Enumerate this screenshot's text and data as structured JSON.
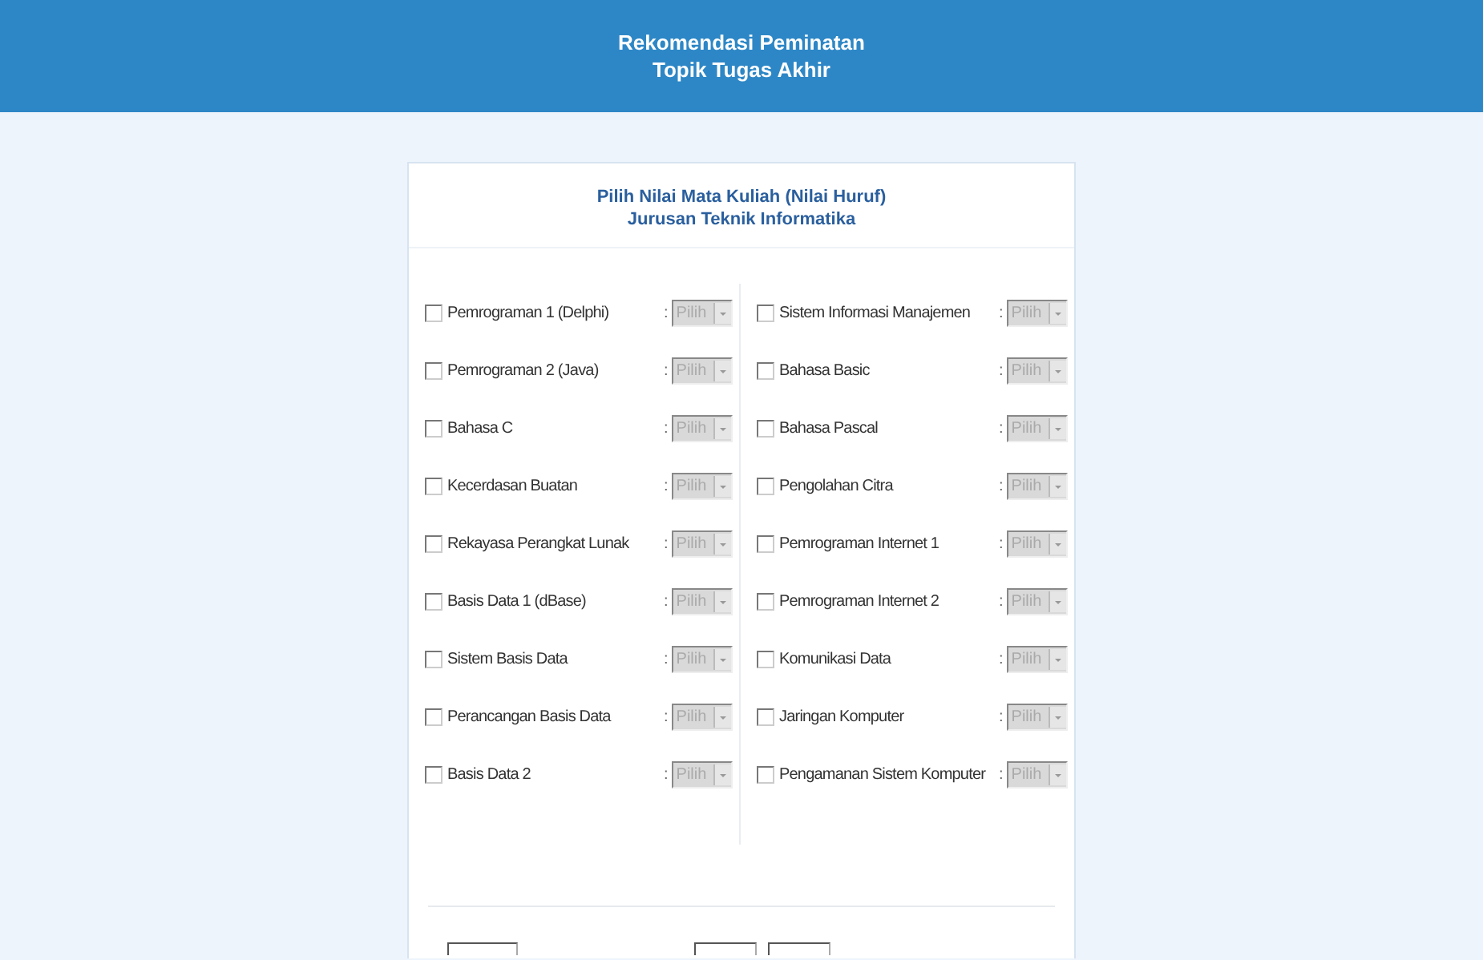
{
  "header": {
    "title_lines": [
      "Rekomendasi Peminatan",
      "Topik Tugas Akhir"
    ]
  },
  "form": {
    "title_lines": [
      "Pilih Nilai Mata Kuliah (Nilai Huruf)",
      "Jurusan Teknik Informatika"
    ],
    "columns": [
      [
        {
          "label": "Pemrograman 1 (Delphi)",
          "checked": false,
          "separator": ":",
          "grade": "Pilih",
          "disabled": true
        },
        {
          "label": "Pemrograman 2 (Java)",
          "checked": false,
          "separator": ":",
          "grade": "Pilih",
          "disabled": true
        },
        {
          "label": "Bahasa C",
          "checked": false,
          "separator": ":",
          "grade": "Pilih",
          "disabled": true
        },
        {
          "label": "Kecerdasan Buatan",
          "checked": false,
          "separator": ":",
          "grade": "Pilih",
          "disabled": true
        },
        {
          "label": "Rekayasa Perangkat Lunak",
          "checked": false,
          "separator": ":",
          "grade": "Pilih",
          "disabled": true
        },
        {
          "label": "Basis Data 1 (dBase)",
          "checked": false,
          "separator": ":",
          "grade": "Pilih",
          "disabled": true
        },
        {
          "label": "Sistem Basis Data",
          "checked": false,
          "separator": ":",
          "grade": "Pilih",
          "disabled": true
        },
        {
          "label": "Perancangan Basis Data",
          "checked": false,
          "separator": ":",
          "grade": "Pilih",
          "disabled": true
        },
        {
          "label": "Basis Data 2",
          "checked": false,
          "separator": ":",
          "grade": "Pilih",
          "disabled": true
        }
      ],
      [
        {
          "label": "Sistem Informasi Manajemen",
          "checked": false,
          "separator": ":",
          "grade": "Pilih",
          "disabled": true
        },
        {
          "label": "Bahasa Basic",
          "checked": false,
          "separator": ":",
          "grade": "Pilih",
          "disabled": true
        },
        {
          "label": "Bahasa Pascal",
          "checked": false,
          "separator": ":",
          "grade": "Pilih",
          "disabled": true
        },
        {
          "label": "Pengolahan Citra",
          "checked": false,
          "separator": ":",
          "grade": "Pilih",
          "disabled": true
        },
        {
          "label": "Pemrograman Internet 1",
          "checked": false,
          "separator": ":",
          "grade": "Pilih",
          "disabled": true
        },
        {
          "label": "Pemrograman Internet 2",
          "checked": false,
          "separator": ":",
          "grade": "Pilih",
          "disabled": true
        },
        {
          "label": "Komunikasi Data",
          "checked": false,
          "separator": ":",
          "grade": "Pilih",
          "disabled": true
        },
        {
          "label": "Jaringan Komputer",
          "checked": false,
          "separator": ":",
          "grade": "Pilih",
          "disabled": true
        },
        {
          "label": "Pengamanan Sistem Komputer",
          "checked": false,
          "separator": ":",
          "grade": "Pilih",
          "disabled": true
        }
      ]
    ],
    "buttons": [
      {
        "kind": "left"
      },
      {
        "kind": "right"
      },
      {
        "kind": "right"
      }
    ]
  }
}
